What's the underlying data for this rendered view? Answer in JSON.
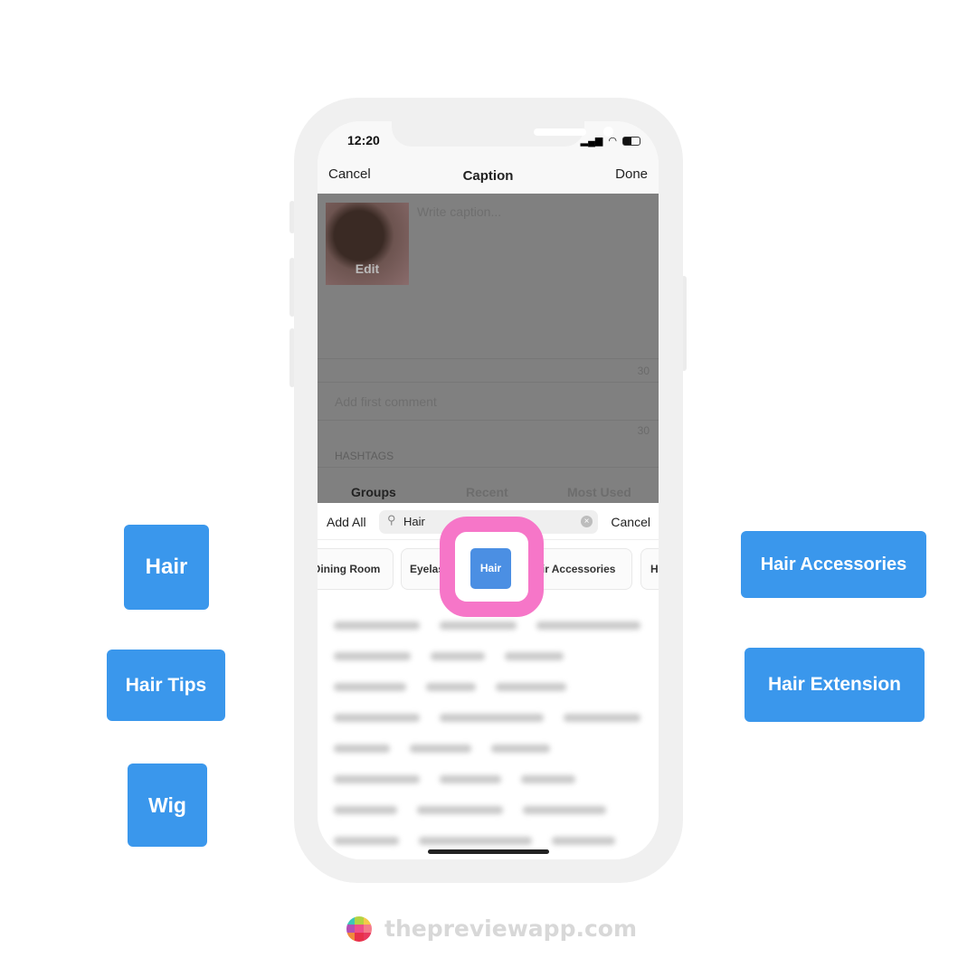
{
  "status": {
    "time": "12:20"
  },
  "nav": {
    "cancel": "Cancel",
    "title": "Caption",
    "done": "Done"
  },
  "caption": {
    "edit": "Edit",
    "placeholder": "Write caption...",
    "count": "30"
  },
  "comment": {
    "placeholder": "Add first comment",
    "count": "30"
  },
  "hashtags": {
    "label": "HASHTAGS",
    "tabs": [
      "Groups",
      "Recent",
      "Most Used"
    ]
  },
  "search": {
    "add_all": "Add All",
    "value": "Hair",
    "cancel": "Cancel"
  },
  "chips": [
    "Dining Room",
    "Eyelashes",
    "Hair",
    "Hair Accessories",
    "H"
  ],
  "labels": [
    "Hair",
    "Hair Tips",
    "Wig",
    "Hair Accessories",
    "Hair Extension"
  ],
  "footer": {
    "brand": "thepreviewapp.com"
  },
  "colors": {
    "accent": "#3a97ec",
    "highlight": "#f676c8",
    "chip_selected": "#4b8fe3"
  }
}
